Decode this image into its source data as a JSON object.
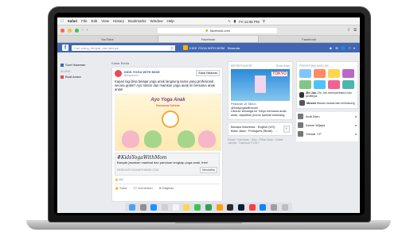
{
  "menubar": {
    "apple": "",
    "app": "Safari",
    "items": [
      "File",
      "Edit",
      "View",
      "History",
      "Bookmarks",
      "Window",
      "Help"
    ],
    "clock": "Fri 11:06 PM"
  },
  "browser": {
    "url": "facebook.com",
    "tabs": [
      "YouTube",
      "Facebook",
      "Facebook"
    ]
  },
  "facebook": {
    "search_placeholder": "Cari orang, tempat, dan lainnya",
    "user_name": "KIDS YOGA WITH MOM",
    "nav_home": "Beranda"
  },
  "left_nav": {
    "item1": "Sunt Halaman",
    "section": "ACARA",
    "item2": "Buat Acara"
  },
  "feed": {
    "header": "Kabar Berita",
    "post": {
      "author": "KIDS YOGA WITH MOM",
      "sub": "Bersponsor",
      "like_button": "Sukai Halaman",
      "text": "Kapan lagi bisa belajar yoga anak langsung sama yang profesional secara gratis? Ayo tonton dan mainkan yoga anak ini bersama anak anda!",
      "image_title": "Ayo Yoga Anak",
      "image_subtitle": "Bersama Dahlan",
      "link_title": "#KidsYogaWithMom",
      "link_desc": "Banyak jawaban manfaat dan panduan lengkap yoga anak, free!",
      "link_domain": "SERIOUSYOGAWITHMOM.COM",
      "link_button": "Mendaftar",
      "reactions": "111",
      "actions": [
        "Suka",
        "Komentari",
        "Bagikan"
      ]
    }
  },
  "sponsored": {
    "header": "BERSPONSOR",
    "create": "Buat Iklan",
    "ad_badge": "TOKYO",
    "ad_title": "Pesiarah 15 Tahun",
    "ad_handle": "@kidsyogawithmom",
    "ad_text": "Liburan keluarga ke Tokyo bersama anak-anak, dapatkan promo spesial sekarang.",
    "lang_text": "Bahasa Indonesia · English (US) · Basa Jawa · Português (Brasil) · ...",
    "footer": "Privasi · Ketentuan · Iklan · Pilihan Iklan · Cookie · Lainnya · Facebook © 2017"
  },
  "right_panel": {
    "header": "PERISTIWA HARI INI",
    "story_name": "Zhi Jun",
    "story_text": "Zhi Jun memperbarui foto profilnya",
    "story2_name": "Musisi",
    "story2_text": "Musisi musisi lain terhubung"
  },
  "contacts": [
    {
      "name": "Andi Baru"
    },
    {
      "name": "Azkan Wijaya"
    },
    {
      "name": "Yanuar J.P"
    }
  ],
  "colors": {
    "fb_blue": "#4267b2",
    "page_bg": "#e9ebee",
    "link": "#385898"
  }
}
